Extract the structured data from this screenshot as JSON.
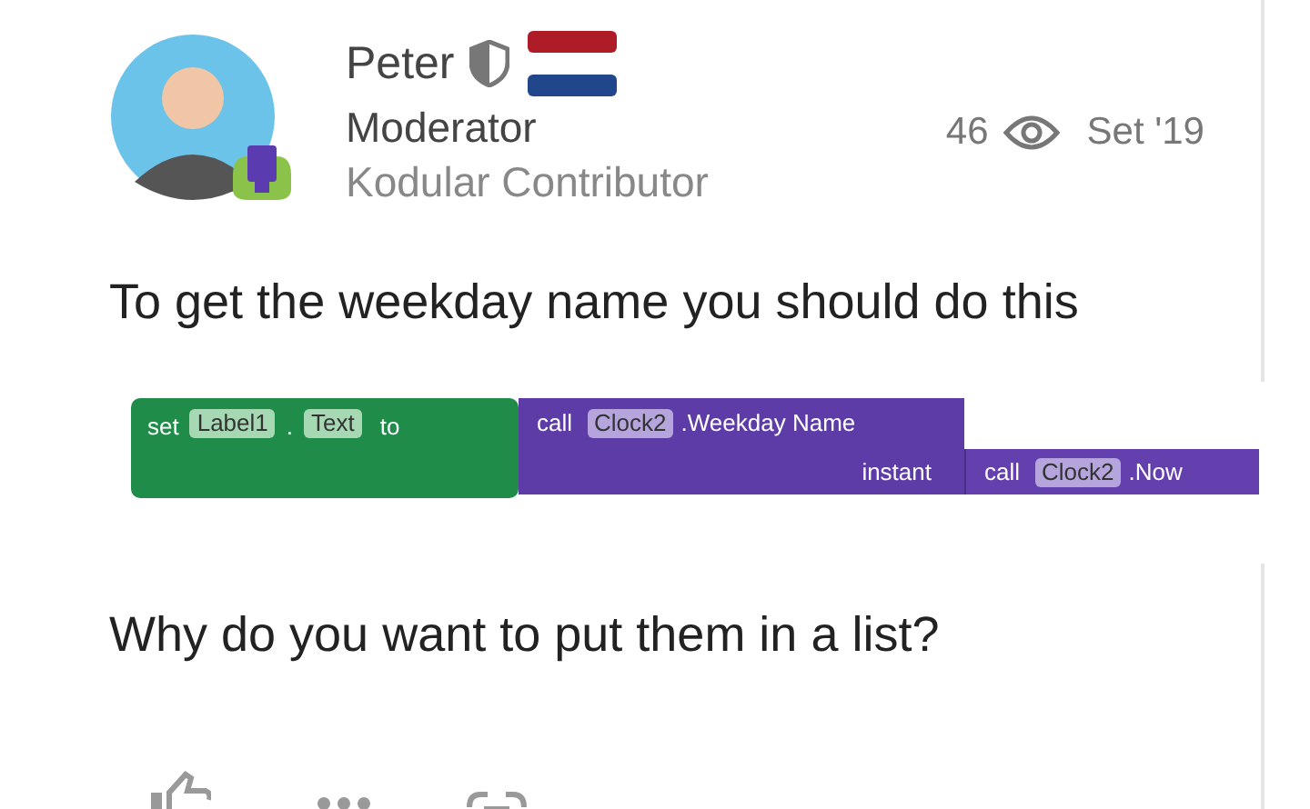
{
  "post": {
    "author": {
      "name": "Peter",
      "title": "Moderator",
      "group": "Kodular Contributor"
    },
    "views": "46",
    "date": "Set '19",
    "paragraphs": [
      "To get the weekday name you should do this",
      "Why do you want to put them in a list?"
    ],
    "blocks": {
      "set_block": {
        "keyword": "set",
        "component": "Label1",
        "dot": ".",
        "property": "Text",
        "to": "to"
      },
      "call_block": {
        "keyword": "call",
        "component": "Clock2",
        "method": ".Weekday Name",
        "socket": "instant"
      },
      "inner_block": {
        "keyword": "call",
        "component": "Clock2",
        "method": ".Now"
      }
    }
  }
}
